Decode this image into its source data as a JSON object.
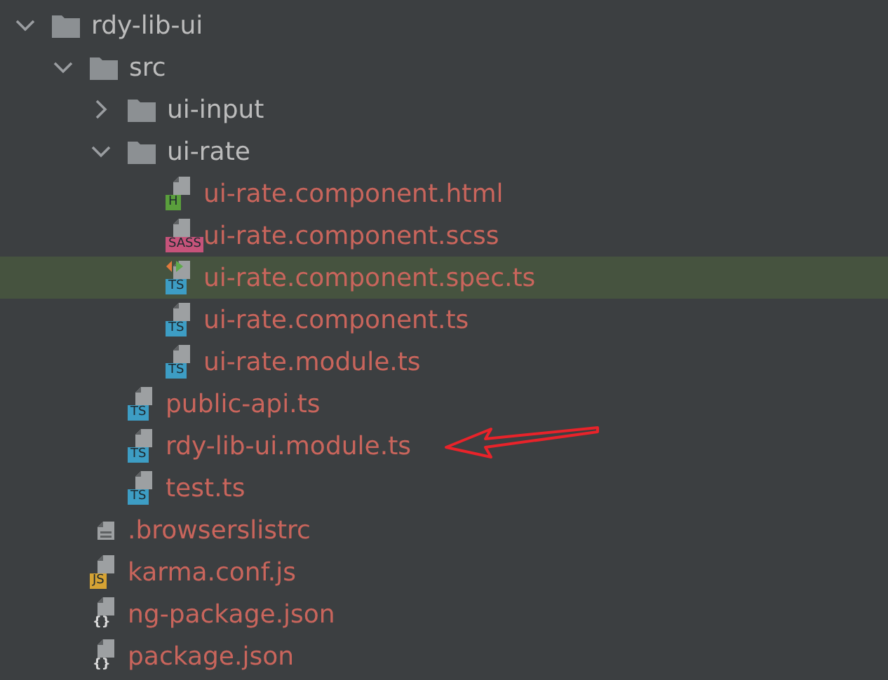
{
  "tree": [
    {
      "kind": "folder",
      "name": "rdy-lib-ui",
      "expanded": true,
      "selected": false,
      "children": [
        {
          "kind": "folder",
          "name": "src",
          "expanded": true,
          "selected": false,
          "children": [
            {
              "kind": "folder",
              "name": "ui-input",
              "expanded": false,
              "selected": false
            },
            {
              "kind": "folder",
              "name": "ui-rate",
              "expanded": true,
              "selected": false,
              "children": [
                {
                  "kind": "html",
                  "name": "ui-rate.component.html",
                  "badge": "H",
                  "runnable": false,
                  "selected": false
                },
                {
                  "kind": "sass",
                  "name": "ui-rate.component.scss",
                  "badge": "SASS",
                  "runnable": false,
                  "selected": false
                },
                {
                  "kind": "ts",
                  "name": "ui-rate.component.spec.ts",
                  "badge": "TS",
                  "runnable": true,
                  "selected": true
                },
                {
                  "kind": "ts",
                  "name": "ui-rate.component.ts",
                  "badge": "TS",
                  "runnable": false,
                  "selected": false
                },
                {
                  "kind": "ts",
                  "name": "ui-rate.module.ts",
                  "badge": "TS",
                  "runnable": false,
                  "selected": false
                }
              ]
            },
            {
              "kind": "ts",
              "name": "public-api.ts",
              "badge": "TS",
              "runnable": false,
              "selected": false
            },
            {
              "kind": "ts",
              "name": "rdy-lib-ui.module.ts",
              "badge": "TS",
              "runnable": false,
              "selected": false
            },
            {
              "kind": "ts",
              "name": "test.ts",
              "badge": "TS",
              "runnable": false,
              "selected": false
            }
          ]
        },
        {
          "kind": "text",
          "name": ".browserslistrc",
          "runnable": false,
          "selected": false
        },
        {
          "kind": "js",
          "name": "karma.conf.js",
          "badge": "JS",
          "runnable": false,
          "selected": false
        },
        {
          "kind": "json",
          "name": "ng-package.json",
          "badge": "{}",
          "runnable": false,
          "selected": false
        },
        {
          "kind": "json",
          "name": "package.json",
          "badge": "{}",
          "runnable": false,
          "selected": false
        }
      ]
    }
  ]
}
